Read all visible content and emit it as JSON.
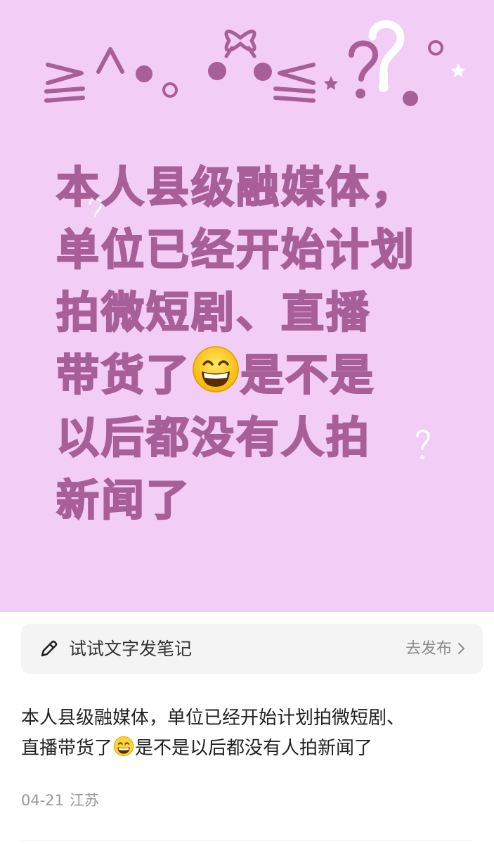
{
  "cover": {
    "background_color": "#f2cdf6",
    "text_color": "#a85f97",
    "decoration": "kaomoji-style doodle: ≥^•∘ •ɞ• ≤⋆?? with stars",
    "headline_lines": [
      "本人县级融媒体，",
      "单位已经开始计划",
      "拍微短剧、直播",
      "带货了",
      "是不是",
      "以后都没有人拍",
      "新闻了"
    ],
    "emoji": "grinning-face-with-smiling-eyes"
  },
  "publish_bar": {
    "icon": "pencil-icon",
    "placeholder": "试试文字发笔记",
    "action_label": "去发布"
  },
  "note": {
    "text_line1": "本人县级融媒体，单位已经开始计划拍微短剧、",
    "text_line2_a": "直播带货了",
    "text_line2_b": "是不是以后都没有人拍新闻了",
    "date": "04-21",
    "location": "江苏"
  }
}
